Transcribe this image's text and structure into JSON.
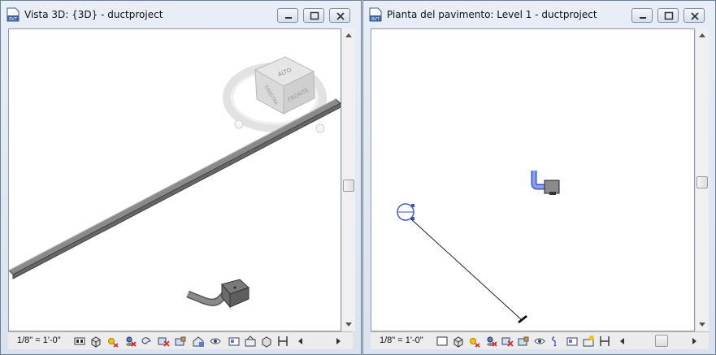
{
  "windows": {
    "left": {
      "title": "Vista 3D: {3D} - ductproject",
      "app_icon_label": "RVT",
      "scale": "1/8\" = 1'-0\"",
      "viewcube": {
        "top": "ALTO",
        "front": "FRONTE",
        "left": "SINISTRA"
      }
    },
    "right": {
      "title": "Pianta del pavimento: Level 1 - ductproject",
      "app_icon_label": "RVT",
      "scale": "1/8\" = 1'-0\""
    }
  },
  "window_controls": [
    "minimize-icon",
    "restore-icon",
    "close-icon"
  ],
  "view_control_icons": [
    "detail-level-icon",
    "visual-style-icon",
    "sun-path-icon",
    "shadows-icon",
    "crop-view-icon",
    "show-crop-icon",
    "unlock-3d-view-icon",
    "temporary-hide-icon",
    "reveal-hidden-icon",
    "temporary-view-properties-icon",
    "analytical-model-icon",
    "highlight-displacement-icon",
    "constraints-icon"
  ],
  "colors": {
    "accent": "#3355cc",
    "duct_gray": "#7d7d7d"
  }
}
